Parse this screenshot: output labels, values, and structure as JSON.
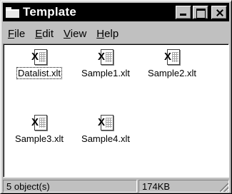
{
  "window": {
    "title": "Template"
  },
  "menu": {
    "file": {
      "mnemonic": "F",
      "rest": "ile"
    },
    "edit": {
      "mnemonic": "E",
      "rest": "dit"
    },
    "view": {
      "mnemonic": "V",
      "rest": "iew"
    },
    "help": {
      "mnemonic": "H",
      "rest": "elp"
    }
  },
  "files": [
    {
      "name": "Datalist.xlt",
      "icon": "excel-template-icon",
      "selected": true
    },
    {
      "name": "Sample1.xlt",
      "icon": "excel-template-icon",
      "selected": false
    },
    {
      "name": "Sample2.xlt",
      "icon": "excel-template-icon",
      "selected": false
    },
    {
      "name": "Sample3.xlt",
      "icon": "excel-template-icon",
      "selected": false
    },
    {
      "name": "Sample4.xlt",
      "icon": "excel-template-icon",
      "selected": false
    }
  ],
  "status": {
    "object_count": "5 object(s)",
    "size": "174KB"
  }
}
